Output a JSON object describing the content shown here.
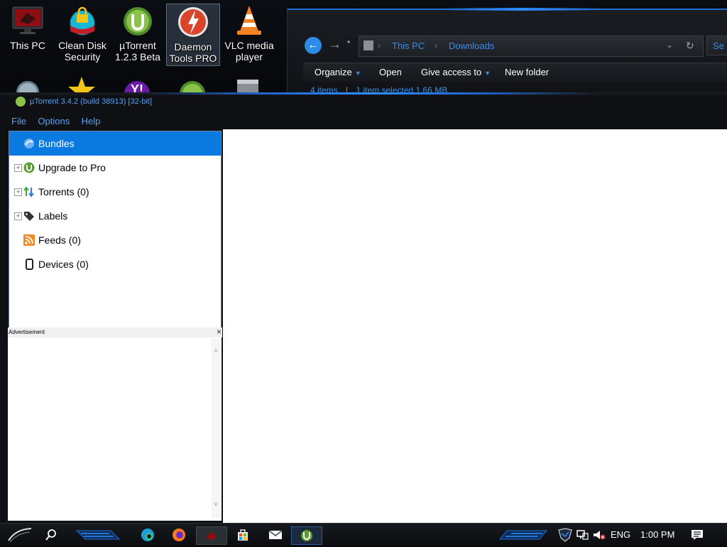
{
  "desktop": {
    "icons": [
      {
        "label1": "This PC",
        "label2": ""
      },
      {
        "label1": "Clean Disk",
        "label2": "Security"
      },
      {
        "label1": "µTorrent",
        "label2": "1.2.3 Beta"
      },
      {
        "label1": "Daemon",
        "label2": "Tools PRO"
      },
      {
        "label1": "VLC media",
        "label2": "player"
      }
    ]
  },
  "explorer": {
    "breadcrumb": [
      "This PC",
      "Downloads"
    ],
    "search_placeholder": "Se",
    "commands": {
      "organize": "Organize",
      "open": "Open",
      "give_access": "Give access to",
      "new_folder": "New folder"
    },
    "status": {
      "items": "4 items",
      "selected": "1 item selected  1.66 MB"
    }
  },
  "utorrent": {
    "title": "µTorrent 3.4.2  (build 38913) [32-bit]",
    "menu": [
      "File",
      "Options",
      "Help"
    ],
    "tree": [
      {
        "label": "Bundles",
        "icon": "bundles-icon"
      },
      {
        "label": "Upgrade to Pro",
        "icon": "utorrent-pro-icon"
      },
      {
        "label": "Torrents (0)",
        "icon": "torrents-arrows-icon"
      },
      {
        "label": "Labels",
        "icon": "tag-icon"
      },
      {
        "label": "Feeds (0)",
        "icon": "rss-feed-icon"
      },
      {
        "label": "Devices (0)",
        "icon": "device-icon"
      }
    ],
    "ad_label": "Advertisement",
    "ad_close": "×"
  },
  "taskbar": {
    "language": "ENG",
    "time": "1:00 PM"
  },
  "colors": {
    "accent_blue": "#0a79e0",
    "link_blue": "#3a8ee6",
    "glow_blue": "#2d8cff"
  }
}
